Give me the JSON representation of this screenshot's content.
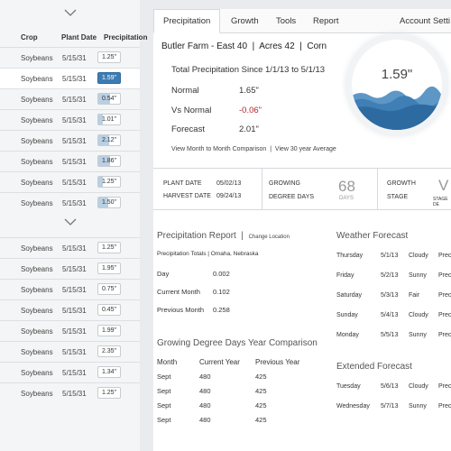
{
  "left_panel": {
    "headers": {
      "crop": "Crop",
      "plant_date": "Plant Date",
      "precipitation": "Precipitation"
    },
    "group1": [
      {
        "crop": "Soybeans",
        "date": "5/15/31",
        "precip": "1.25\"",
        "level": 0
      },
      {
        "crop": "Soybeans",
        "date": "5/15/31",
        "precip": "1.59\"",
        "level": 1.0,
        "selected": true
      },
      {
        "crop": "Soybeans",
        "date": "5/15/31",
        "precip": "0.54\"",
        "level": 0.55
      },
      {
        "crop": "Soybeans",
        "date": "5/15/31",
        "precip": "1.01\"",
        "level": 0.2
      },
      {
        "crop": "Soybeans",
        "date": "5/15/31",
        "precip": "2.12\"",
        "level": 0.5
      },
      {
        "crop": "Soybeans",
        "date": "5/15/31",
        "precip": "1.86\"",
        "level": 0.55
      },
      {
        "crop": "Soybeans",
        "date": "5/15/31",
        "precip": "1.25\"",
        "level": 0.2
      },
      {
        "crop": "Soybeans",
        "date": "5/15/31",
        "precip": "1.50\"",
        "level": 0.45
      }
    ],
    "group2": [
      {
        "crop": "Soybeans",
        "date": "5/15/31",
        "precip": "1.25\""
      },
      {
        "crop": "Soybeans",
        "date": "5/15/31",
        "precip": "1.95\""
      },
      {
        "crop": "Soybeans",
        "date": "5/15/31",
        "precip": "0.75\""
      },
      {
        "crop": "Soybeans",
        "date": "5/15/31",
        "precip": "0.45\""
      },
      {
        "crop": "Soybeans",
        "date": "5/15/31",
        "precip": "1.99\""
      },
      {
        "crop": "Soybeans",
        "date": "5/15/31",
        "precip": "2.35\""
      },
      {
        "crop": "Soybeans",
        "date": "5/15/31",
        "precip": "1.34\""
      },
      {
        "crop": "Soybeans",
        "date": "5/15/31",
        "precip": "1.25\""
      }
    ]
  },
  "tabs": [
    "Precipitation",
    "Growth",
    "Tools",
    "Report"
  ],
  "account_label": "Account Setti",
  "farm": {
    "name": "Butler Farm - East 40",
    "acres": "Acres 42",
    "crop": "Corn"
  },
  "total": {
    "label": "Total Precipitation Since 1/1/13  to  5/1/13"
  },
  "stats": [
    {
      "label": "Normal",
      "value": "1.65\"",
      "neg": false
    },
    {
      "label": "Vs Normal",
      "value": "-0.06\"",
      "neg": true
    },
    {
      "label": "Forecast",
      "value": "2.01\"",
      "neg": false
    }
  ],
  "links": {
    "a": "View Month to Month Comparison",
    "sep": "|",
    "b": "View 30 year Average"
  },
  "gauge": {
    "value": "1.59\"",
    "accent": "#3f7fb5"
  },
  "dates": {
    "plant_label": "PLANT DATE",
    "plant_value": "05/02/13",
    "harvest_label": "HARVEST DATE",
    "harvest_value": "09/24/13"
  },
  "gdd": {
    "label1": "GROWING",
    "label2": "DEGREE DAYS",
    "value": "68",
    "unit": "DAYS"
  },
  "growth_stage": {
    "label1": "GROWTH",
    "label2": "STAGE",
    "value": "V",
    "sub": "STAGE DE"
  },
  "precip_report": {
    "title": "Precipitation Report",
    "sep": "|",
    "change": "Change Location",
    "subtitle": "Precipitation Totals  |  Omaha, Nebraska",
    "rows": [
      {
        "label": "Day",
        "value": "0.002"
      },
      {
        "label": "Current Month",
        "value": "0.102"
      },
      {
        "label": "Previous Month",
        "value": "0.258"
      }
    ]
  },
  "gdd_compare": {
    "title": "Growing Degree Days Year Comparison",
    "headers": [
      "Month",
      "Current Year",
      "Previous Year"
    ],
    "rows": [
      [
        "Sept",
        "480",
        "425"
      ],
      [
        "Sept",
        "480",
        "425"
      ],
      [
        "Sept",
        "480",
        "425"
      ],
      [
        "Sept",
        "480",
        "425"
      ]
    ]
  },
  "weather": {
    "title": "Weather Forecast",
    "rows": [
      [
        "Thursday",
        "5/1/13",
        "Cloudy",
        "Preci"
      ],
      [
        "Friday",
        "5/2/13",
        "Sunny",
        "Preci"
      ],
      [
        "Saturday",
        "5/3/13",
        "Fair",
        "Preci"
      ],
      [
        "Sunday",
        "5/4/13",
        "Cloudy",
        "Preci"
      ],
      [
        "Monday",
        "5/5/13",
        "Sunny",
        "Preci"
      ]
    ]
  },
  "extended": {
    "title": "Extended Forecast",
    "rows": [
      [
        "Tuesday",
        "5/6/13",
        "Cloudy",
        "Preci"
      ],
      [
        "Wednesday",
        "5/7/13",
        "Sunny",
        "Preci"
      ]
    ]
  }
}
